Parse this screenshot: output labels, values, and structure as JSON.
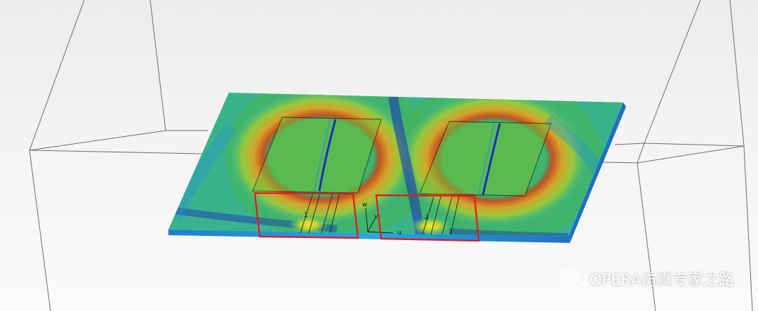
{
  "scene": {
    "axis_labels": {
      "w": "w",
      "v": "v",
      "u": "u"
    },
    "port_labels": {
      "port1": "1",
      "port2": "2"
    },
    "highlight_color": "#e8141c",
    "field_colors": [
      "#1a2fb8",
      "#1f8fd8",
      "#2db7a3",
      "#39b34a",
      "#b7d22c",
      "#f0c020",
      "#e26a1a",
      "#b8281a"
    ]
  },
  "watermark": {
    "icon": "wechat-icon",
    "text": "OPERA仿真专家之路"
  }
}
